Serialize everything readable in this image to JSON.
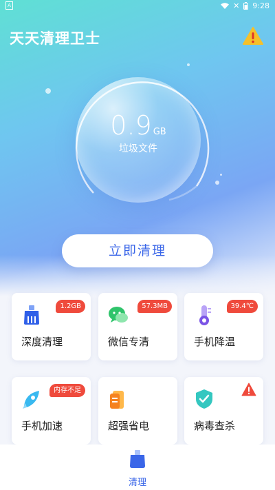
{
  "status": {
    "time": "9:28"
  },
  "app": {
    "title": "天天清理卫士"
  },
  "junk": {
    "size": "0.9",
    "unit": "GB",
    "label": "垃圾文件"
  },
  "actions": {
    "clean_now": "立即清理"
  },
  "cards": [
    {
      "label": "深度清理",
      "badge": "1.2GB",
      "icon": "broom-icon"
    },
    {
      "label": "微信专清",
      "badge": "57.3MB",
      "icon": "wechat-icon"
    },
    {
      "label": "手机降温",
      "badge": "39.4℃",
      "icon": "thermometer-icon"
    },
    {
      "label": "手机加速",
      "badge": "内存不足",
      "icon": "rocket-icon"
    },
    {
      "label": "超强省电",
      "badge": "",
      "icon": "battery-icon"
    },
    {
      "label": "病毒查杀",
      "badge": "",
      "icon": "shield-icon"
    }
  ],
  "nav": {
    "clean": "清理"
  },
  "colors": {
    "accent": "#3a66e8",
    "badge": "#ef4a3c",
    "warning": "#f5c02a"
  }
}
